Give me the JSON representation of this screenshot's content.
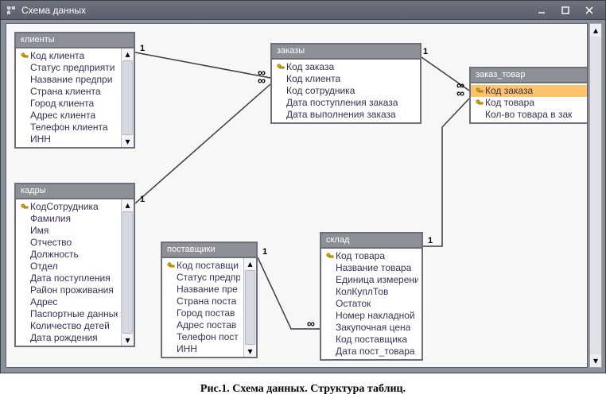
{
  "window": {
    "title": "Схема данных"
  },
  "caption": "Рис.1. Схема данных. Структура таблиц.",
  "entities": {
    "clients": {
      "title": "клиенты",
      "fields": [
        "Код клиента",
        "Статус предприяти",
        "Название предпри",
        "Страна клиента",
        "Город клиента",
        "Адрес клиента",
        "Телефон клиента",
        "ИНН"
      ],
      "keys": [
        0
      ]
    },
    "orders": {
      "title": "заказы",
      "fields": [
        "Код заказа",
        "Код клиента",
        "Код сотрудника",
        "Дата поступления заказа",
        "Дата выполнения заказа"
      ],
      "keys": [
        0
      ]
    },
    "order_item": {
      "title": "заказ_товар",
      "fields": [
        "Код заказа",
        "Код товара",
        "Кол-во товара в зак"
      ],
      "keys": [
        0,
        1
      ],
      "selected": 0
    },
    "staff": {
      "title": "кадры",
      "fields": [
        "КодСотрудника",
        "Фамилия",
        "Имя",
        "Отчество",
        "Должность",
        "Отдел",
        "Дата поступления",
        "Район проживания",
        "Адрес",
        "Паспортные данные",
        "Количество детей",
        "Дата рождения"
      ],
      "keys": [
        0
      ]
    },
    "suppliers": {
      "title": "поставщики",
      "fields": [
        "Код поставщи",
        "Статус предпр",
        "Название пре",
        "Страна поста",
        "Город постав",
        "Адрес постав",
        "Телефон пост",
        "ИНН"
      ],
      "keys": [
        0
      ]
    },
    "stock": {
      "title": "склад",
      "fields": [
        "Код товара",
        "Название товара",
        "Единица измерения",
        "КолКуплТов",
        "Остаток",
        "Номер накладной",
        "Закупочная цена",
        "Код поставщика",
        "Дата пост_товара"
      ],
      "keys": [
        0
      ]
    }
  },
  "relationships": {
    "clients_orders": {
      "left": "1",
      "right": "∞"
    },
    "staff_orders": {
      "left": "1",
      "right": "∞"
    },
    "orders_orderitem": {
      "left": "1",
      "right": "∞"
    },
    "stock_orderitem": {
      "left": "1",
      "right": "∞"
    },
    "suppliers_stock": {
      "left": "1",
      "right": "∞"
    }
  }
}
